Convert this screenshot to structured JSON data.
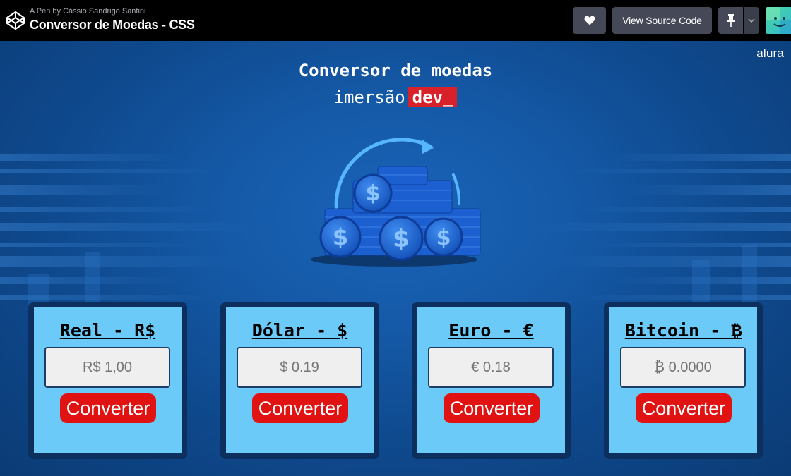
{
  "codepen": {
    "pen_by": "A Pen by Cássio Sandrigo Santini",
    "pen_title": "Conversor de Moedas - CSS",
    "view_source_label": "View Source Code",
    "heart_icon": "heart-icon",
    "pin_icon": "pin-icon",
    "caret_icon": "chevron-down-icon"
  },
  "page": {
    "brand": "alura",
    "title": "Conversor de moedas",
    "subtitle_text": "imersão",
    "subtitle_badge": "dev_"
  },
  "converters": [
    {
      "title": "Real - R$",
      "placeholder": "R$ 1,00",
      "button": "Converter"
    },
    {
      "title": "Dólar - $",
      "placeholder": "$ 0.19",
      "button": "Converter"
    },
    {
      "title": "Euro - €",
      "placeholder": "€ 0.18",
      "button": "Converter"
    },
    {
      "title": "Bitcoin - ₿",
      "placeholder": "₿ 0.0000",
      "button": "Converter"
    }
  ],
  "colors": {
    "accent_red": "#e01212",
    "card_bg": "#6ccaf9",
    "card_border": "#0d2f5e",
    "badge_red": "#d9212a"
  }
}
